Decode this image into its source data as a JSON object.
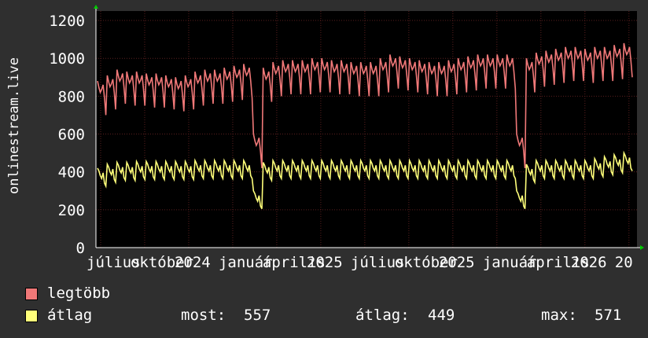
{
  "chart_data": {
    "type": "line",
    "ylabel": "onlinestream.live",
    "ylim": [
      0,
      1250
    ],
    "yticks": [
      0,
      200,
      400,
      600,
      800,
      1000,
      1200
    ],
    "x_tick_labels": [
      "július",
      "október",
      "2024",
      "január",
      "április",
      "2025",
      "július",
      "október",
      "2025",
      "január",
      "április",
      "2026",
      "20"
    ],
    "grid": true,
    "colors": {
      "background": "#000000",
      "canvas": "#2f2f2f",
      "grid": "#5a1f1f",
      "axis": "#ffffff",
      "arrow": "#00cc00"
    },
    "series": [
      {
        "name": "legtöbb",
        "color": "#f07878",
        "base": [
          880,
          910,
          940,
          930,
          930,
          920,
          920,
          910,
          900,
          910,
          930,
          940,
          940,
          950,
          960,
          970,
          600,
          950,
          980,
          990,
          990,
          990,
          1000,
          1000,
          990,
          990,
          980,
          980,
          980,
          1000,
          1020,
          1010,
          1000,
          990,
          980,
          980,
          990,
          1000,
          1010,
          1020,
          1020,
          1020,
          1020,
          600,
          1000,
          1030,
          1040,
          1050,
          1060,
          1060,
          1050,
          1060,
          1060,
          1070,
          1080
        ]
      },
      {
        "name": "átlag",
        "color": "#ffff7a",
        "base": [
          420,
          440,
          450,
          450,
          455,
          455,
          455,
          455,
          455,
          455,
          460,
          460,
          460,
          460,
          460,
          460,
          300,
          450,
          460,
          460,
          460,
          460,
          460,
          460,
          460,
          460,
          460,
          460,
          460,
          460,
          460,
          460,
          460,
          460,
          460,
          460,
          460,
          460,
          460,
          460,
          460,
          460,
          460,
          300,
          440,
          460,
          460,
          460,
          460,
          460,
          460,
          470,
          480,
          490,
          500
        ]
      }
    ]
  },
  "legend": [
    {
      "label": "legtöbb",
      "color": "#f07878"
    },
    {
      "label": "átlag",
      "color": "#ffff7a"
    }
  ],
  "stats": {
    "most_label": "most:",
    "most_value": "557",
    "avg_label": "átlag:",
    "avg_value": "449",
    "max_label": "max:",
    "max_value": "571"
  }
}
